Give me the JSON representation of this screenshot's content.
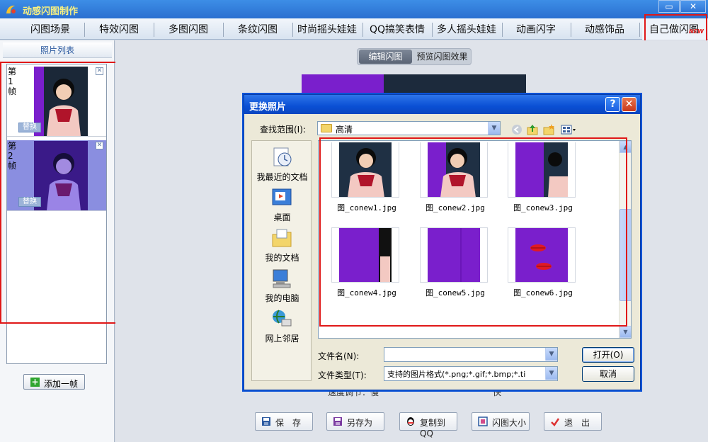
{
  "app": {
    "title": "动感闪图制作",
    "minimize_icon": "minimize-icon",
    "close_icon": "close-icon"
  },
  "tabs": [
    {
      "label": "闪图场景"
    },
    {
      "label": "特效闪图"
    },
    {
      "label": "多图闪图"
    },
    {
      "label": "条纹闪图"
    },
    {
      "label": "时尚摇头娃娃"
    },
    {
      "label": "QQ搞笑表情"
    },
    {
      "label": "多人摇头娃娃"
    },
    {
      "label": "动画闪字"
    },
    {
      "label": "动感饰品"
    },
    {
      "label": "自己做闪图",
      "badge": "NEW"
    }
  ],
  "left_panel": {
    "title": "照片列表",
    "frames": [
      {
        "label": "第1帧",
        "replace_label": "替换"
      },
      {
        "label": "第2帧",
        "replace_label": "替换"
      }
    ],
    "add_frame_label": "添加一帧"
  },
  "main": {
    "mode_tabs": {
      "edit": "编辑闪图",
      "preview": "预览闪图效果"
    },
    "speed_label": "速度调节：慢",
    "speed_end": "快",
    "buttons": {
      "save": "保　存",
      "save_as": "另存为",
      "copy_qq": "复制到QQ",
      "size": "闪图大小",
      "exit": "退　出"
    }
  },
  "dialog": {
    "title": "更换照片",
    "help_label": "?",
    "close_label": "✕",
    "look_in_label": "查找范围(I):",
    "look_in_value": "高清",
    "places": [
      {
        "label": "我最近的文档",
        "icon": "recent-documents-icon"
      },
      {
        "label": "桌面",
        "icon": "desktop-icon"
      },
      {
        "label": "我的文档",
        "icon": "my-documents-icon"
      },
      {
        "label": "我的电脑",
        "icon": "my-computer-icon"
      },
      {
        "label": "网上邻居",
        "icon": "network-places-icon"
      }
    ],
    "files": [
      {
        "name": "图_conew1.jpg"
      },
      {
        "name": "图_conew2.jpg"
      },
      {
        "name": "图_conew3.jpg"
      },
      {
        "name": "图_conew4.jpg"
      },
      {
        "name": "图_conew5.jpg"
      },
      {
        "name": "图_conew6.jpg"
      }
    ],
    "filename_label": "文件名(N):",
    "filename_value": "",
    "filetype_label": "文件类型(T):",
    "filetype_value": "支持的图片格式(*.png;*.gif;*.bmp;*.ti",
    "open_label": "打开(O)",
    "cancel_label": "取消"
  },
  "colors": {
    "highlight_red": "#e01818",
    "purple": "#7a1fcc",
    "titlebar_blue": "#2a6fd0"
  }
}
